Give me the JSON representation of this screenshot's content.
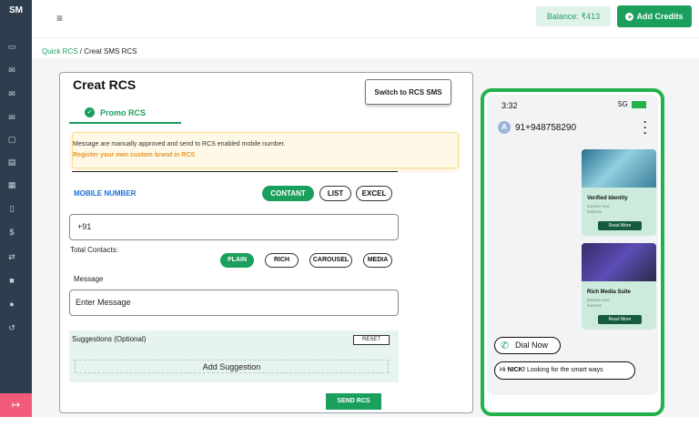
{
  "sidebar": {
    "brand": "SM",
    "items": [
      {
        "icon": "desktop-icon",
        "glyph": "▭"
      },
      {
        "icon": "mail-icon",
        "glyph": "✉"
      },
      {
        "icon": "mail-icon",
        "glyph": "✉"
      },
      {
        "icon": "mail-icon",
        "glyph": "✉"
      },
      {
        "icon": "chat-icon",
        "glyph": "▢"
      },
      {
        "icon": "sms-icon",
        "glyph": "▤"
      },
      {
        "icon": "document-icon",
        "glyph": "▦"
      },
      {
        "icon": "file-icon",
        "glyph": "▯"
      },
      {
        "icon": "dollar-icon",
        "glyph": "$"
      },
      {
        "icon": "exchange-icon",
        "glyph": "⇄"
      },
      {
        "icon": "video-icon",
        "glyph": "■"
      },
      {
        "icon": "user-icon",
        "glyph": "●"
      },
      {
        "icon": "history-icon",
        "glyph": "↺"
      }
    ],
    "logout_glyph": "↦"
  },
  "header": {
    "menu_glyph": "≡",
    "balance": "Balance: ₹413",
    "add_credits": "Add Credits",
    "plus": "+"
  },
  "breadcrumb": {
    "parent": "Quick RCS",
    "separator": " / ",
    "current": "Creat SMS RCS"
  },
  "form": {
    "title": "Creat  RCS",
    "switch_button": "Switch to RCS SMS",
    "tab": "Promo RCS",
    "tab_check": "✓",
    "notice_line1": "Message are manually approved and send to RCS enabled mobile number.",
    "notice_line2": "Register your own custom brand in RCS",
    "mobile_label": "MOBILE NUMBER",
    "source_buttons": [
      "CONTANT",
      "LIST",
      "EXCEL"
    ],
    "number_value": "+91",
    "total_contacts": "Total Contacts:",
    "message_types": [
      "PLAIN",
      "RICH",
      "CAROUSEL",
      "MEDIA"
    ],
    "message_label": "Message",
    "message_value": "Enter Message",
    "suggestions_label": "Suggestions (Optional)",
    "reset": "RESET",
    "add_suggestion": "Add Suggestion",
    "send": "SEND RCS"
  },
  "preview": {
    "time": "3:32",
    "network": "5G",
    "avatar": "A",
    "contact": "91+948758290",
    "cards": [
      {
        "title": "Verified Identity",
        "subtitle": "Explore new features",
        "button": "Read More"
      },
      {
        "title": "Rich Media Suite",
        "subtitle": "Explore new features",
        "button": "Read More"
      }
    ],
    "dial_chip": "Dial Now",
    "greeting_prefix": "Hi ",
    "greeting_name": "NICK!",
    "greeting_rest": " Looking for the smart ways"
  },
  "colors": {
    "accent": "#1a9f5d",
    "sidebar": "#2f3e4e",
    "logout": "#f25c7a",
    "phone_frame": "#22b14c"
  }
}
